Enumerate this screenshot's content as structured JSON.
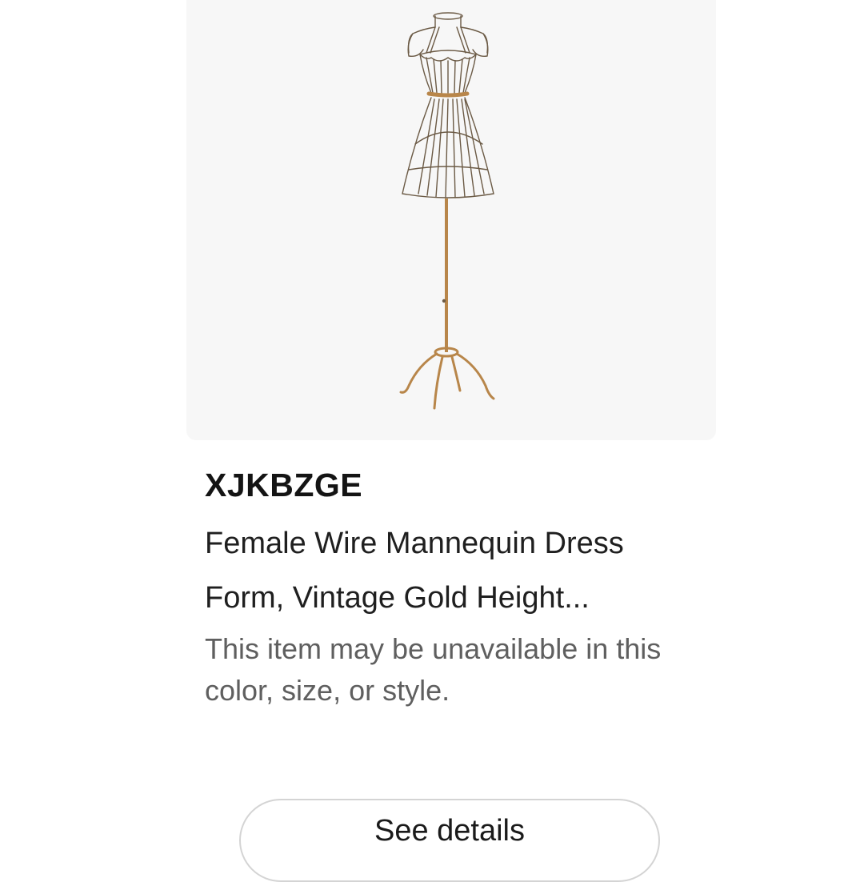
{
  "product": {
    "brand": "XJKBZGE",
    "title": "Female Wire Mannequin Dress Form, Vintage Gold Height...",
    "availability_note": "This item may be unavailable in this color, size, or style.",
    "image_icon": "wire-mannequin-dress-form"
  },
  "actions": {
    "see_details_label": "See details"
  },
  "colors": {
    "image_background": "#f7f7f7",
    "wire": "#6b5a45",
    "gold_stand": "#b8864a",
    "note_text": "#5f5f5f",
    "button_border": "#d4d4d4"
  }
}
